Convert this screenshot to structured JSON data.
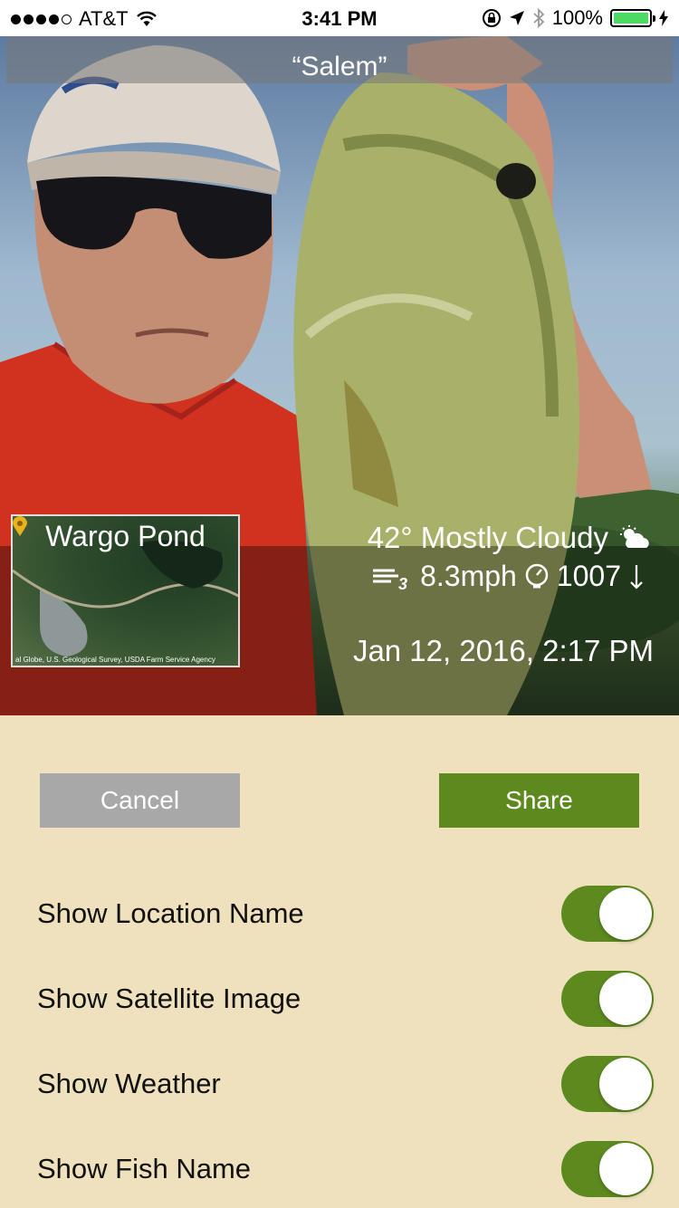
{
  "status_bar": {
    "carrier": "AT&T",
    "time": "3:41 PM",
    "battery": "100%"
  },
  "photo": {
    "fish_name": "“Salem”",
    "location_name": "Wargo Pond",
    "map_credit": "al Globe, U.S. Geological Survey, USDA Farm Service Agency",
    "weather": "42° Mostly Cloudy",
    "wind_speed": "8.3mph",
    "pressure": "1007",
    "datetime": "Jan 12, 2016, 2:17 PM"
  },
  "actions": {
    "cancel_label": "Cancel",
    "share_label": "Share"
  },
  "options": [
    {
      "label": "Show Location Name",
      "on": true
    },
    {
      "label": "Show Satellite Image",
      "on": true
    },
    {
      "label": "Show Weather",
      "on": true
    },
    {
      "label": "Show Fish Name",
      "on": true
    }
  ],
  "colors": {
    "background": "#efe1bd",
    "accent": "#5c8a1e",
    "cancel": "#a8a8a8"
  }
}
